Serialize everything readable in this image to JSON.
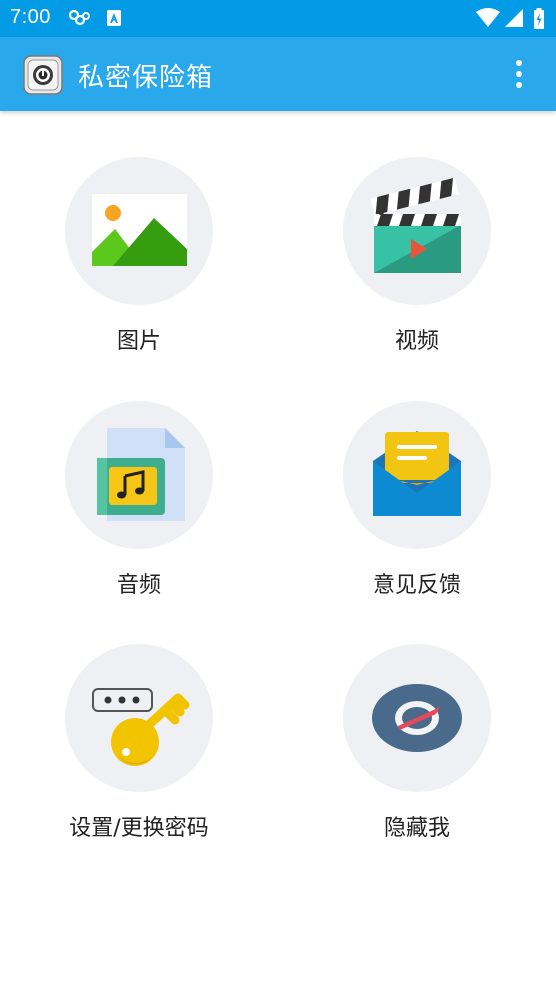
{
  "status_bar": {
    "time": "7:00",
    "icons": [
      "notification-icon",
      "keyboard-icon",
      "wifi-icon",
      "signal-icon",
      "battery-icon"
    ]
  },
  "app_bar": {
    "title": "私密保险箱",
    "logo_icon": "safe-icon",
    "menu_icon": "more-vert-icon"
  },
  "grid": {
    "items": [
      {
        "label": "图片",
        "icon": "picture-icon"
      },
      {
        "label": "视频",
        "icon": "video-clapper-icon"
      },
      {
        "label": "音频",
        "icon": "audio-file-icon"
      },
      {
        "label": "意见反馈",
        "icon": "feedback-envelope-icon"
      },
      {
        "label": "设置/更换密码",
        "icon": "password-key-icon"
      },
      {
        "label": "隐藏我",
        "icon": "hide-eye-icon"
      }
    ]
  },
  "colors": {
    "status_bar": "#039be5",
    "app_bar": "#29a9ec",
    "circle_bg": "#eef0f3"
  }
}
